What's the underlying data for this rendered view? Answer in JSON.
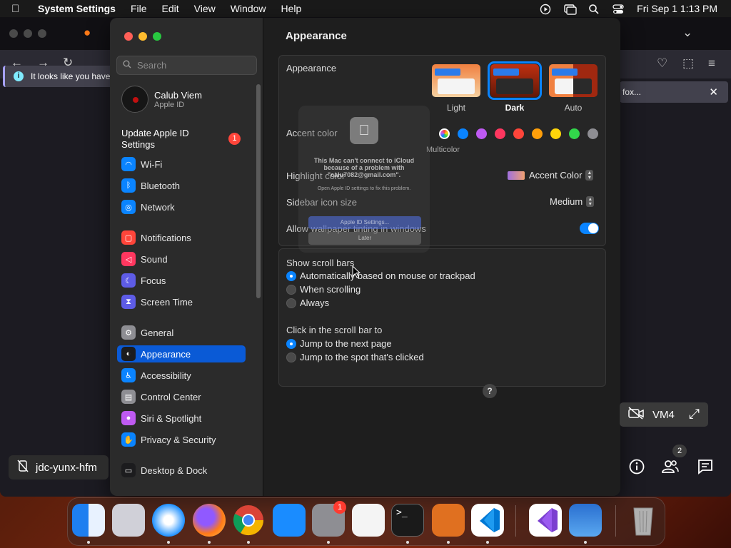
{
  "menubar": {
    "app": "System Settings",
    "items": [
      "File",
      "Edit",
      "View",
      "Window",
      "Help"
    ],
    "clock": "Fri Sep 1  1:13 PM"
  },
  "browser": {
    "notification": "It looks like you have",
    "notification_right": "fox..."
  },
  "settings": {
    "search_placeholder": "Search",
    "profile": {
      "name": "Calub Viem",
      "sub": "Apple ID"
    },
    "update": {
      "label": "Update Apple ID Settings",
      "badge": "1"
    },
    "sidebar": [
      {
        "label": "Wi-Fi",
        "icon": "wifi-icon",
        "color": "#0a84ff",
        "glyph": "◠"
      },
      {
        "label": "Bluetooth",
        "icon": "bluetooth-icon",
        "color": "#0a84ff",
        "glyph": "ᛒ"
      },
      {
        "label": "Network",
        "icon": "network-icon",
        "color": "#0a84ff",
        "glyph": "◎"
      },
      {
        "label": "Notifications",
        "icon": "notifications-icon",
        "color": "#ff453a",
        "glyph": "▢"
      },
      {
        "label": "Sound",
        "icon": "sound-icon",
        "color": "#ff375f",
        "glyph": "◁"
      },
      {
        "label": "Focus",
        "icon": "focus-icon",
        "color": "#5e5ce6",
        "glyph": "☾"
      },
      {
        "label": "Screen Time",
        "icon": "hourglass-icon",
        "color": "#5e5ce6",
        "glyph": "⧗"
      },
      {
        "label": "General",
        "icon": "gear-icon",
        "color": "#8e8e93",
        "glyph": "⚙"
      },
      {
        "label": "Appearance",
        "icon": "appearance-icon",
        "color": "#1c1c1e",
        "glyph": "◐"
      },
      {
        "label": "Accessibility",
        "icon": "accessibility-icon",
        "color": "#0a84ff",
        "glyph": "♿"
      },
      {
        "label": "Control Center",
        "icon": "control-center-icon",
        "color": "#8e8e93",
        "glyph": "▤"
      },
      {
        "label": "Siri & Spotlight",
        "icon": "siri-icon",
        "color": "#bf5af2",
        "glyph": "●"
      },
      {
        "label": "Privacy & Security",
        "icon": "hand-icon",
        "color": "#0a84ff",
        "glyph": "✋"
      },
      {
        "label": "Desktop & Dock",
        "icon": "dock-icon",
        "color": "#1c1c1e",
        "glyph": "▭"
      }
    ],
    "selected": "Appearance",
    "title": "Appearance",
    "appearance": {
      "label": "Appearance",
      "options": [
        "Light",
        "Dark",
        "Auto"
      ],
      "selected": "Dark"
    },
    "accent": {
      "label": "Accent color",
      "multicolor": "Multicolor",
      "colors": [
        "#0a84ff",
        "#bf5af2",
        "#ff375f",
        "#ff453a",
        "#ff9f0a",
        "#ffd60a",
        "#32d74b",
        "#8e8e93"
      ]
    },
    "highlight": {
      "label": "Highlight color",
      "value": "Accent Color"
    },
    "sidebar_icon_size": {
      "label": "Sidebar icon size",
      "value": "Medium"
    },
    "wallpaper_tinting": {
      "label": "Allow wallpaper tinting in windows",
      "on": true
    },
    "scroll_bars": {
      "label": "Show scroll bars",
      "options": [
        "Automatically based on mouse or trackpad",
        "When scrolling",
        "Always"
      ],
      "selected": 0
    },
    "click_scroll": {
      "label": "Click in the scroll bar to",
      "options": [
        "Jump to the next page",
        "Jump to the spot that's clicked"
      ],
      "selected": 0
    },
    "help": "?"
  },
  "dialog": {
    "title": "This Mac can't connect to iCloud because of a problem with \"calu7082@gmail.com\".",
    "subtitle": "Open Apple ID settings to fix this problem.",
    "primary": "Apple ID Settings...",
    "secondary": "Later"
  },
  "remote": {
    "vm_label": "VM4",
    "host": "jdc-yunx-hfm",
    "participants_badge": "2"
  },
  "dock": {
    "badge": "1",
    "apps": [
      {
        "name": "finder-icon",
        "color": "#2a8cf0"
      },
      {
        "name": "launchpad-icon",
        "color": "#d0d0d8"
      },
      {
        "name": "safari-icon",
        "color": "#1e90ff"
      },
      {
        "name": "firefox-icon",
        "color": "#ff7a18"
      },
      {
        "name": "chrome-icon",
        "color": "#e8e8e8"
      },
      {
        "name": "app-store-icon",
        "color": "#1a8cff"
      },
      {
        "name": "system-settings-icon",
        "color": "#8e8e93"
      },
      {
        "name": "textedit-icon",
        "color": "#f4f4f4"
      },
      {
        "name": "terminal-icon",
        "color": "#1a1a1a"
      },
      {
        "name": "garageband-icon",
        "color": "#e07020"
      },
      {
        "name": "vscode-icon",
        "color": "#ffffff"
      },
      {
        "name": "visual-studio-icon",
        "color": "#ffffff"
      },
      {
        "name": "weather-icon",
        "color": "#3a8fe0"
      },
      {
        "name": "trash-icon",
        "color": "#9a9a9a"
      }
    ]
  }
}
